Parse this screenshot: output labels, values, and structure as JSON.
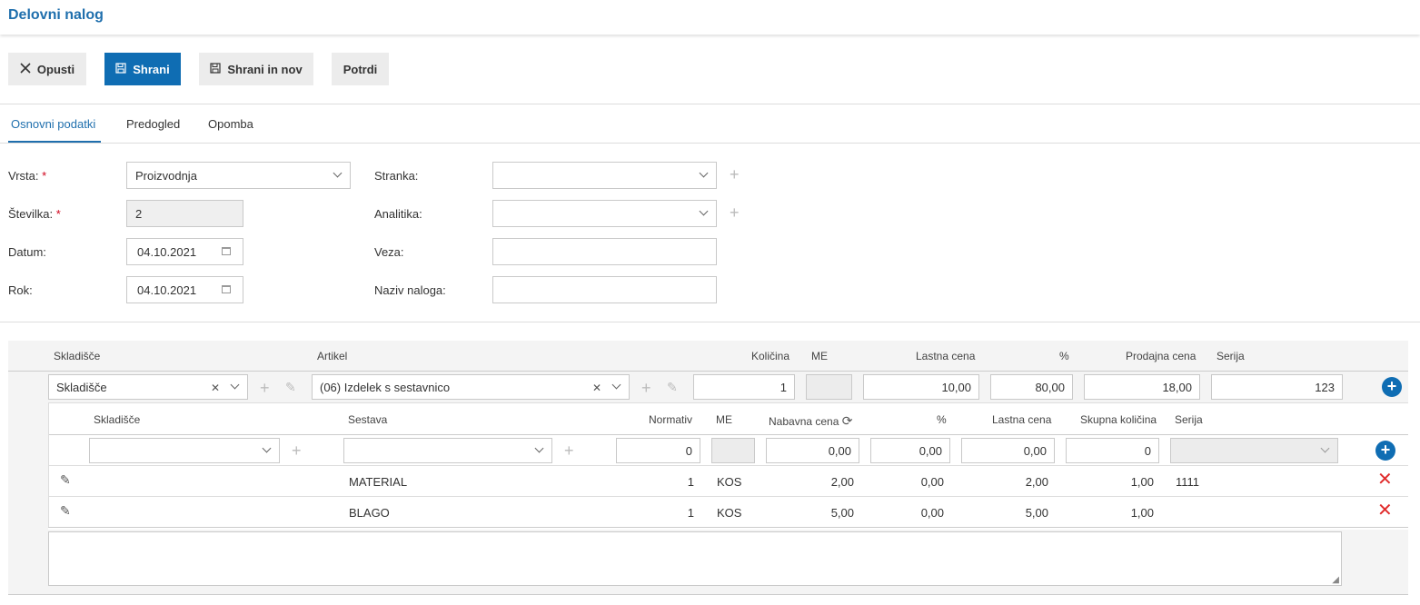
{
  "title": "Delovni nalog",
  "toolbar": {
    "cancel": "Opusti",
    "save": "Shrani",
    "save_new": "Shrani in nov",
    "confirm": "Potrdi"
  },
  "tabs": [
    "Osnovni podatki",
    "Predogled",
    "Opomba"
  ],
  "form": {
    "vrsta_label": "Vrsta:",
    "vrsta_value": "Proizvodnja",
    "stevilka_label": "Številka:",
    "stevilka_value": "2",
    "datum_label": "Datum:",
    "datum_value": "04.10.2021",
    "rok_label": "Rok:",
    "rok_value": "04.10.2021",
    "stranka_label": "Stranka:",
    "analitika_label": "Analitika:",
    "veza_label": "Veza:",
    "naziv_label": "Naziv naloga:",
    "required_mark": "*"
  },
  "main_grid": {
    "headers": {
      "skladisce": "Skladišče",
      "artikel": "Artikel",
      "kolicina": "Količina",
      "me": "ME",
      "lastna_cena": "Lastna cena",
      "pct": "%",
      "prodajna_cena": "Prodajna cena",
      "serija": "Serija"
    },
    "row": {
      "skladisce": "Skladišče",
      "artikel": "(06) Izdelek s sestavnico",
      "kolicina": "1",
      "me": "",
      "lastna_cena": "10,00",
      "pct": "80,00",
      "prodajna_cena": "18,00",
      "serija": "123"
    }
  },
  "sub_grid": {
    "headers": {
      "skladisce": "Skladišče",
      "sestava": "Sestava",
      "normativ": "Normativ",
      "me": "ME",
      "nabavna_cena": "Nabavna cena",
      "pct": "%",
      "lastna_cena": "Lastna cena",
      "skupna_kolicina": "Skupna količina",
      "serija": "Serija"
    },
    "input_row": {
      "normativ": "0",
      "nabavna_cena": "0,00",
      "pct": "0,00",
      "lastna_cena": "0,00",
      "skupna_kolicina": "0"
    },
    "rows": [
      {
        "sestava": "MATERIAL",
        "normativ": "1",
        "me": "KOS",
        "nabavna_cena": "2,00",
        "pct": "0,00",
        "lastna_cena": "2,00",
        "skupna_kolicina": "1,00",
        "serija": "1111"
      },
      {
        "sestava": "BLAGO",
        "normativ": "1",
        "me": "KOS",
        "nabavna_cena": "5,00",
        "pct": "0,00",
        "lastna_cena": "5,00",
        "skupna_kolicina": "1,00",
        "serija": ""
      }
    ]
  },
  "icons": {
    "close": "close-icon",
    "save": "floppy-icon",
    "plus": "plus-icon",
    "pencil": "pencil-icon",
    "refresh": "refresh-icon",
    "delete": "delete-x-icon",
    "calendar": "calendar-icon"
  },
  "colors": {
    "accent": "#0f6db3",
    "title": "#1f6fad",
    "required": "#d0021b",
    "delete": "#e02b2b"
  }
}
